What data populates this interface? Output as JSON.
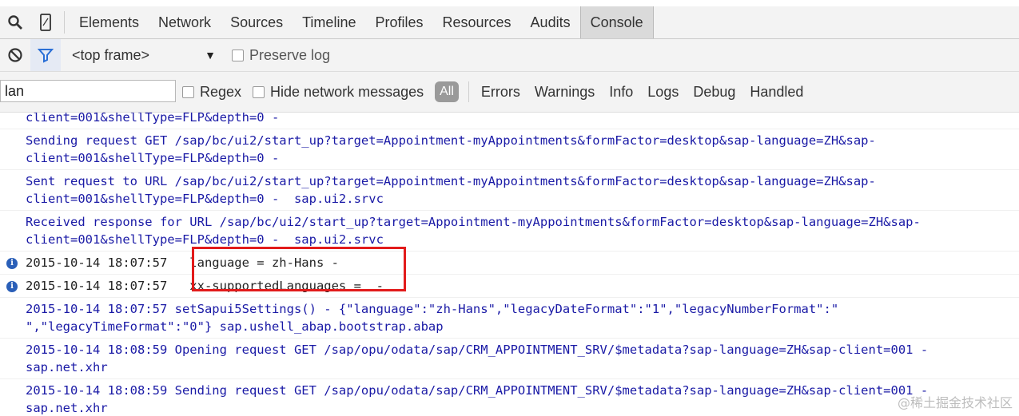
{
  "tabs": {
    "items": [
      "Elements",
      "Network",
      "Sources",
      "Timeline",
      "Profiles",
      "Resources",
      "Audits",
      "Console"
    ],
    "selected": "Console"
  },
  "filterbar": {
    "frame": "<top frame>",
    "preserve_log": "Preserve log"
  },
  "levelbar": {
    "search_value": "lan",
    "regex": "Regex",
    "hide_network": "Hide network messages",
    "all": "All",
    "levels": [
      "Errors",
      "Warnings",
      "Info",
      "Logs",
      "Debug",
      "Handled"
    ]
  },
  "messages": [
    {
      "text": "client=001&shellType=FLP&depth=0 -",
      "black": false,
      "info": false
    },
    {
      "text": "Sending request GET /sap/bc/ui2/start_up?target=Appointment-myAppointments&formFactor=desktop&sap-language=ZH&sap-\nclient=001&shellType=FLP&depth=0 -",
      "black": false,
      "info": false
    },
    {
      "text": "Sent request to URL /sap/bc/ui2/start_up?target=Appointment-myAppointments&formFactor=desktop&sap-language=ZH&sap-\nclient=001&shellType=FLP&depth=0 -  sap.ui2.srvc",
      "black": false,
      "info": false
    },
    {
      "text": "Received response for URL /sap/bc/ui2/start_up?target=Appointment-myAppointments&formFactor=desktop&sap-language=ZH&sap-\nclient=001&shellType=FLP&depth=0 -  sap.ui2.srvc",
      "black": false,
      "info": false
    },
    {
      "text": "2015-10-14 18:07:57   language = zh-Hans -",
      "black": true,
      "info": true
    },
    {
      "text": "2015-10-14 18:07:57   xx-supportedLanguages =  -",
      "black": true,
      "info": true
    },
    {
      "text": "2015-10-14 18:07:57 setSapui5Settings() - {\"language\":\"zh-Hans\",\"legacyDateFormat\":\"1\",\"legacyNumberFormat\":\"\n\",\"legacyTimeFormat\":\"0\"} sap.ushell_abap.bootstrap.abap",
      "black": false,
      "info": false
    },
    {
      "text": "2015-10-14 18:08:59 Opening request GET /sap/opu/odata/sap/CRM_APPOINTMENT_SRV/$metadata?sap-language=ZH&sap-client=001 -\nsap.net.xhr",
      "black": false,
      "info": false
    },
    {
      "text": "2015-10-14 18:08:59 Sending request GET /sap/opu/odata/sap/CRM_APPOINTMENT_SRV/$metadata?sap-language=ZH&sap-client=001 -\nsap.net.xhr",
      "black": false,
      "info": false
    }
  ],
  "watermark": "@稀土掘金技术社区",
  "colors": {
    "log_blue": "#1a1aa6",
    "highlight_red": "#e21b1b",
    "info_icon": "#2a5fb8"
  },
  "icons": [
    "search-icon",
    "device-mode-icon",
    "clear-console-icon",
    "filter-icon",
    "dropdown-caret-icon",
    "info-icon"
  ]
}
